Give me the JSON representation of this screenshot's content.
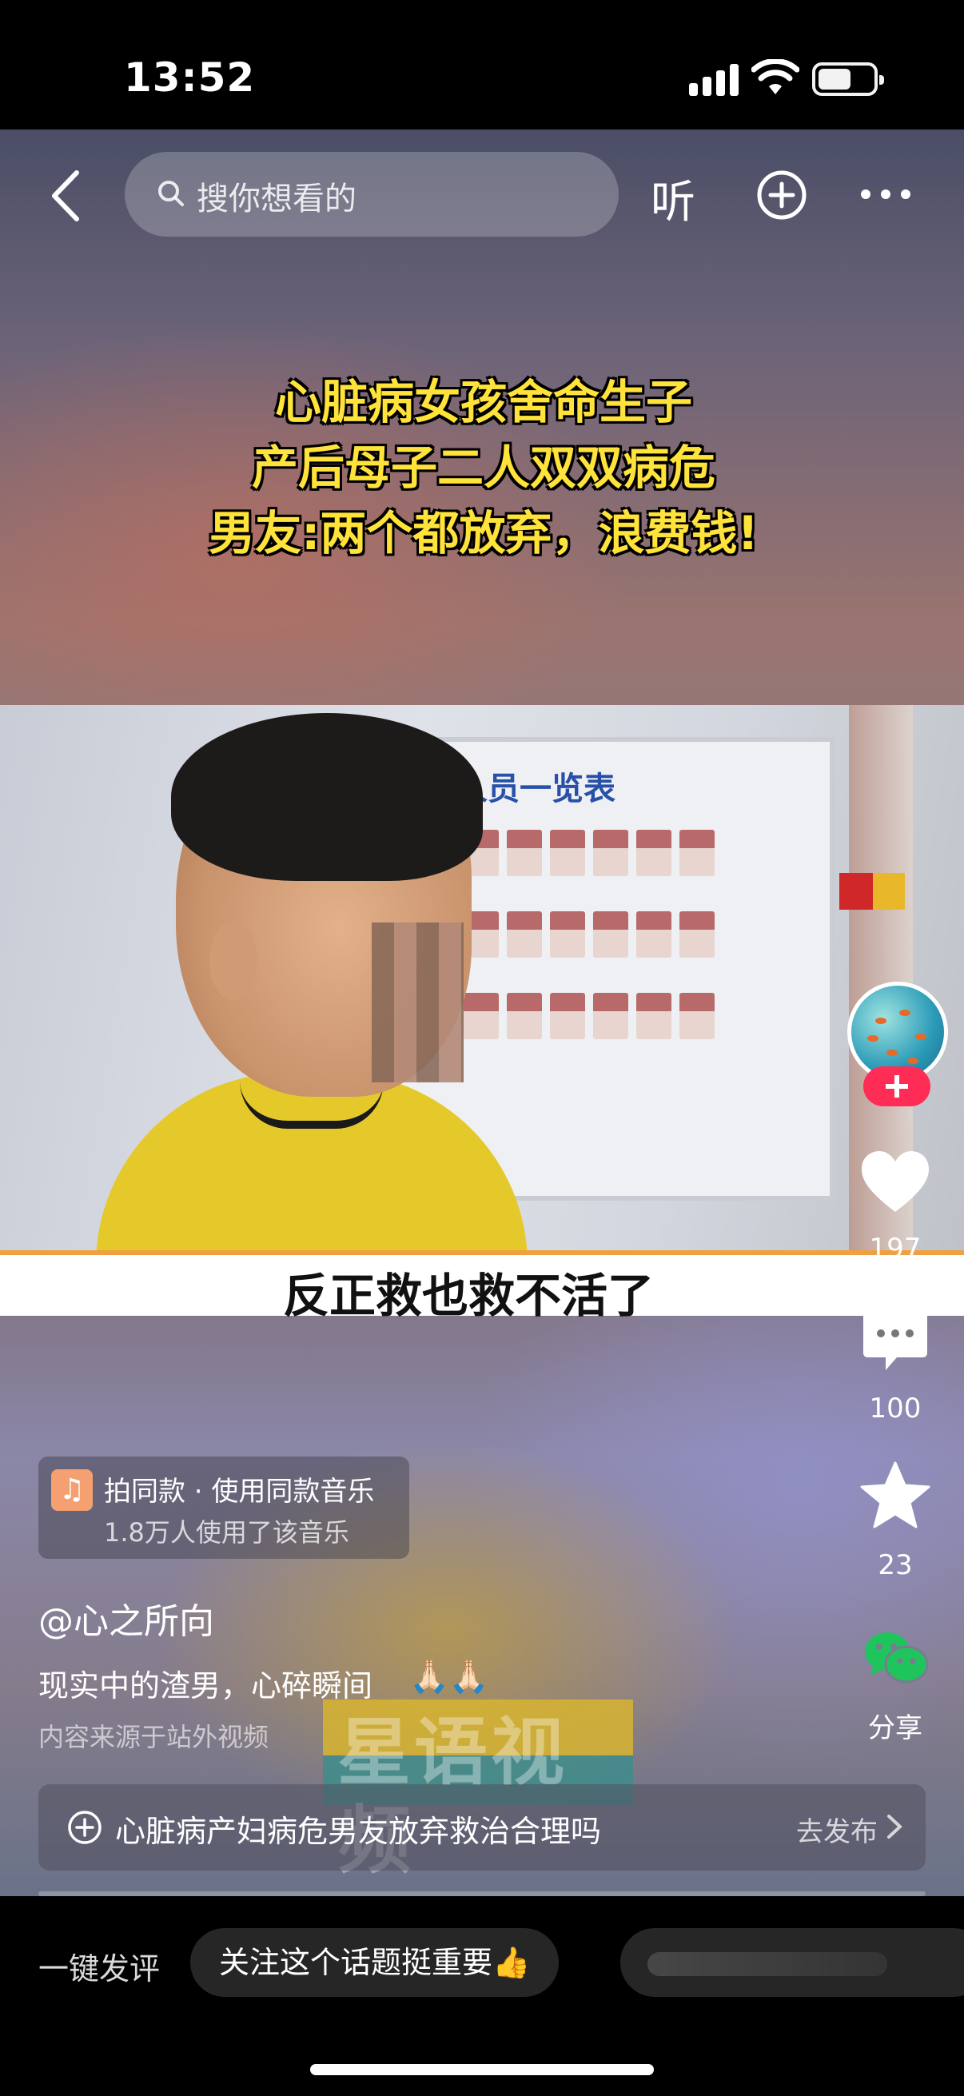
{
  "status_bar": {
    "time": "13:52"
  },
  "top_nav": {
    "search_placeholder": "搜你想看的",
    "listen_label": "听"
  },
  "video": {
    "headline_lines": [
      "心脏病女孩舍命生子",
      "产后母子二人双双病危",
      "男友:两个都放弃，浪费钱!"
    ],
    "board_title": "人员一览表",
    "subtitle": "反正救也救不活了"
  },
  "actions": {
    "likes": "197",
    "comments": "100",
    "favorites": "23",
    "share_label": "分享"
  },
  "music": {
    "title": "拍同款 · 使用同款音乐",
    "usage": "1.8万人使用了该音乐"
  },
  "post": {
    "author": "@心之所向",
    "description": "现实中的渣男，心碎瞬间",
    "emoji": "🙏🏻🙏🏻",
    "source": "内容来源于站外视频",
    "watermark": "星语视频"
  },
  "topic": {
    "text": "心脏病产妇病危男友放弃救治合理吗",
    "action": "去发布"
  },
  "comment_bar": {
    "quick_label": "一键发评",
    "chips": [
      "关注这个话题挺重要👍"
    ]
  },
  "colors": {
    "headline": "#ffe23a",
    "follow_badge": "#ff2c55",
    "share_green": "#1fc45c"
  }
}
